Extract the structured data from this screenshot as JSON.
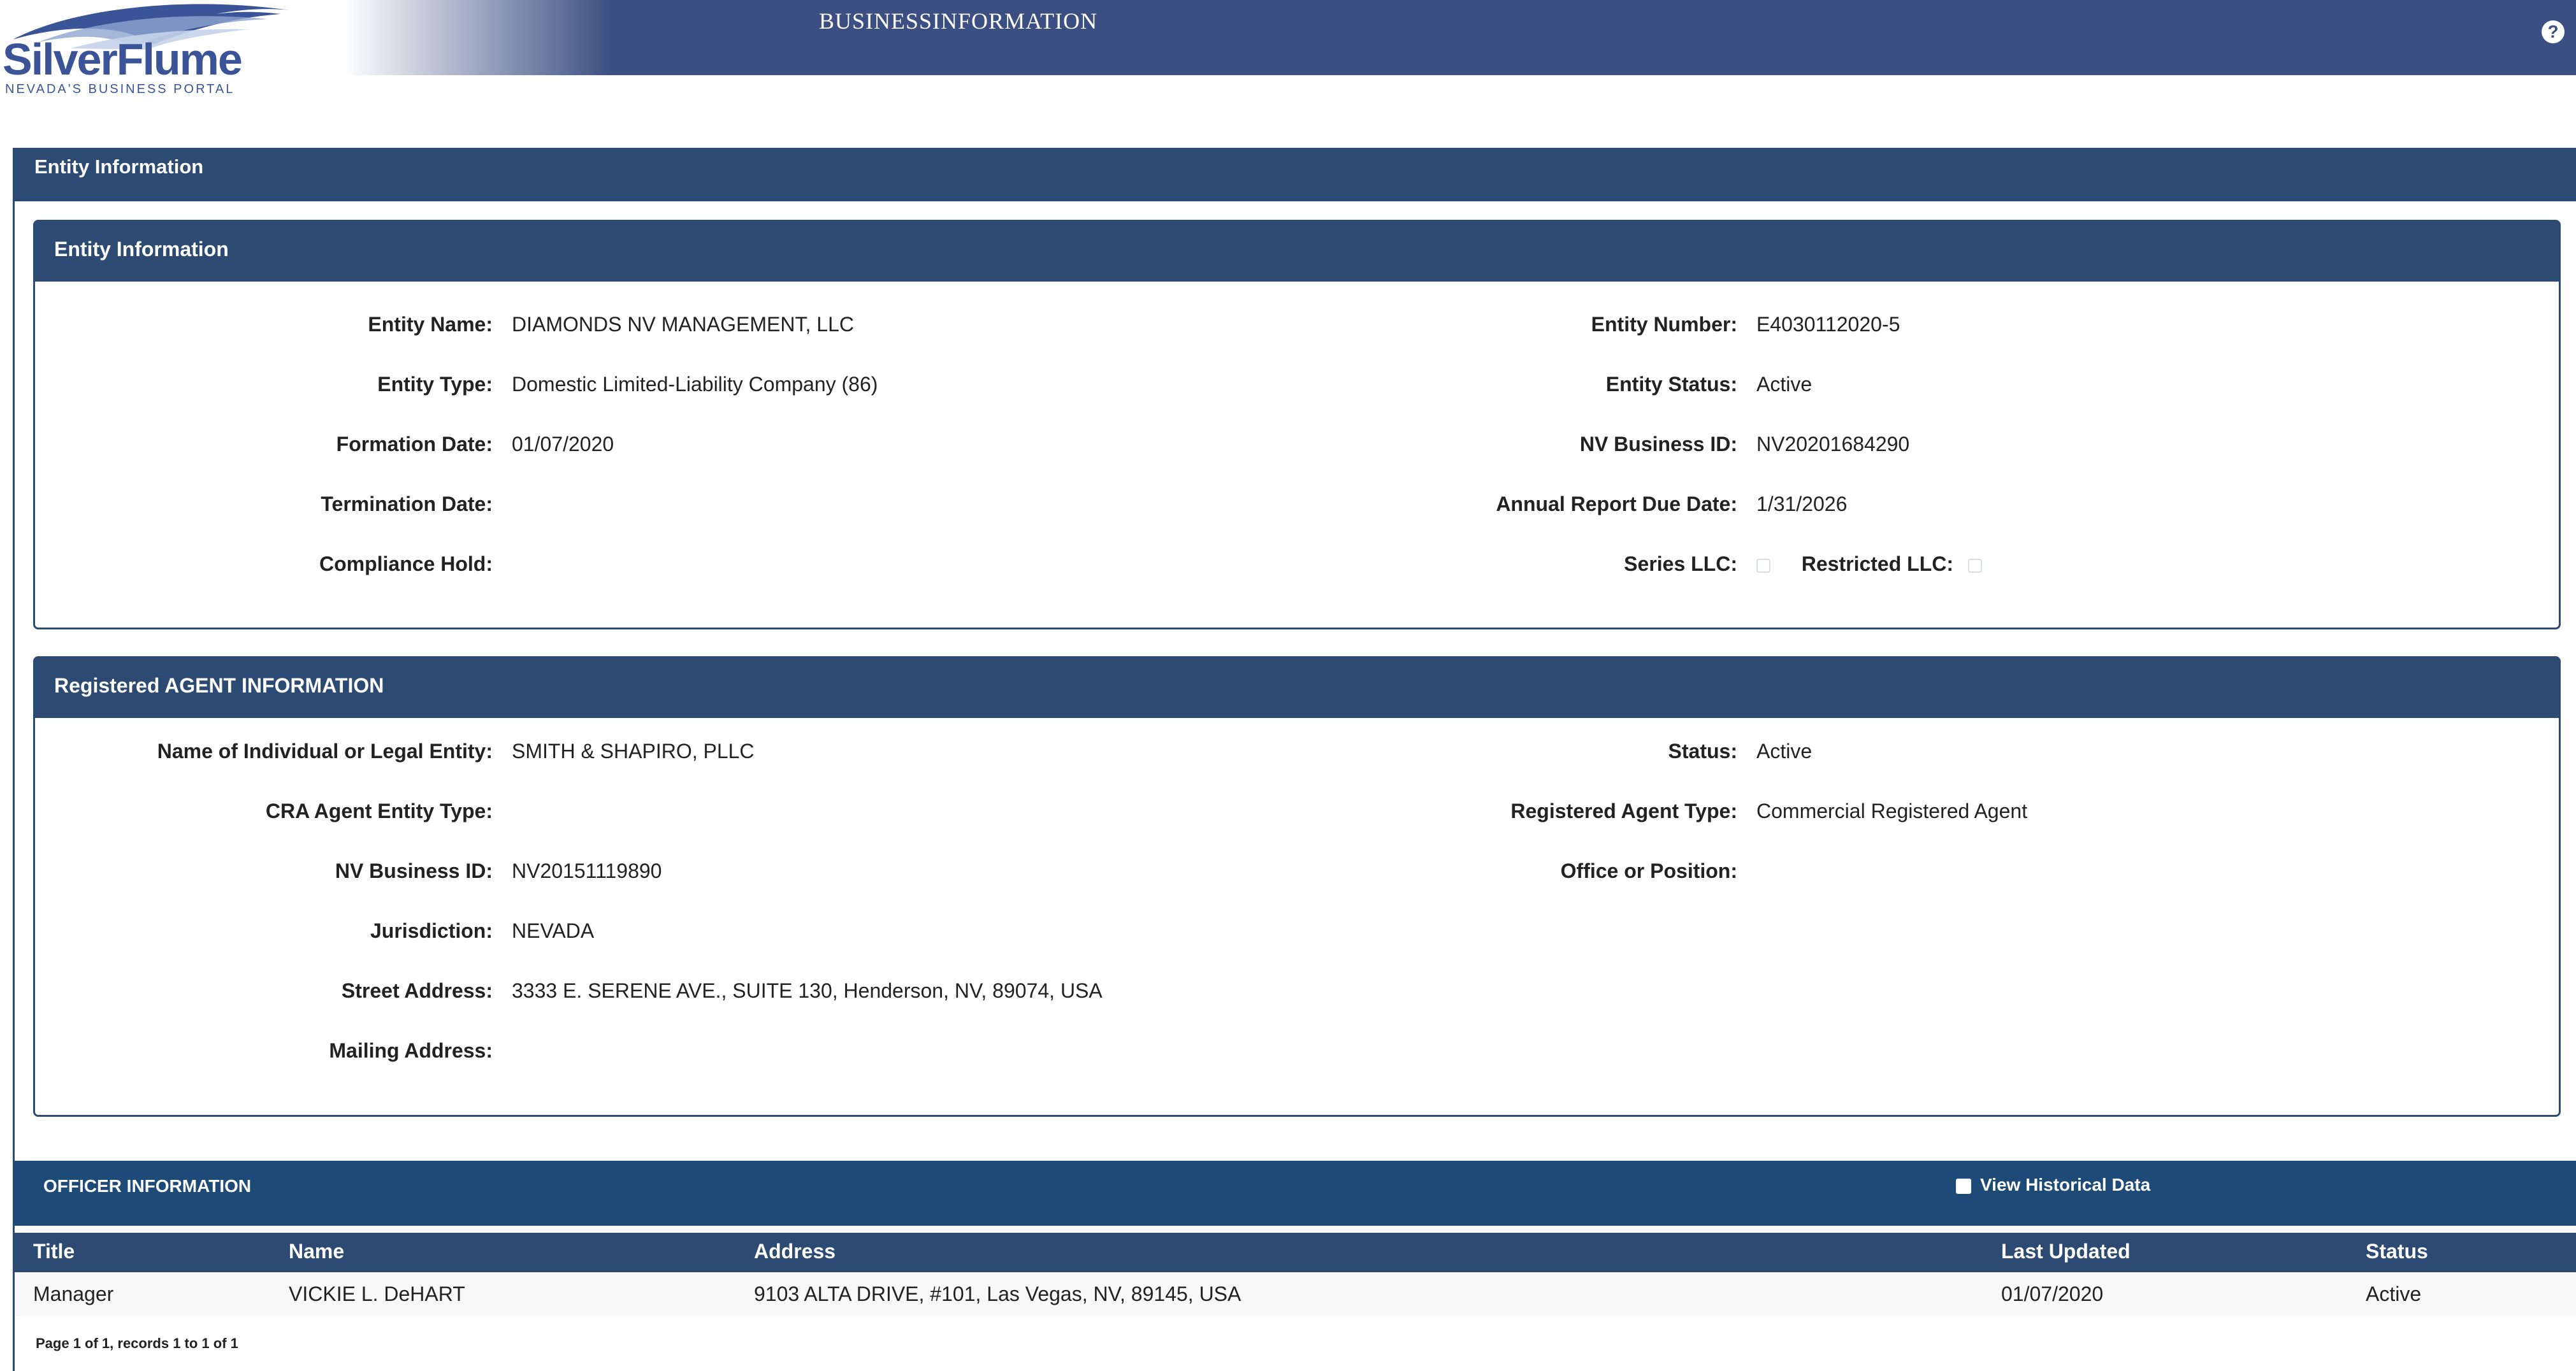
{
  "header": {
    "logo_main": "SilverFlume",
    "logo_sub": "NEVADA'S BUSINESS PORTAL",
    "page_heading": "BUSINESSINFORMATION",
    "help_icon": "question-circle-icon",
    "help_glyph": "?"
  },
  "colors": {
    "header_bar": "#3b4f82",
    "panel_header": "#2d4a72",
    "logo_blue": "#3b5498"
  },
  "outer_panel": {
    "title": "Entity Information"
  },
  "entity": {
    "title": "Entity Information",
    "left": [
      {
        "label": "Entity Name:",
        "value": "DIAMONDS NV MANAGEMENT, LLC"
      },
      {
        "label": "Entity Type:",
        "value": "Domestic Limited-Liability Company (86)"
      },
      {
        "label": "Formation Date:",
        "value": "01/07/2020"
      },
      {
        "label": "Termination Date:",
        "value": ""
      },
      {
        "label": "Compliance Hold:",
        "value": ""
      }
    ],
    "right": [
      {
        "label": "Entity Number:",
        "value": "E4030112020-5"
      },
      {
        "label": "Entity Status:",
        "value": "Active"
      },
      {
        "label": "NV Business ID:",
        "value": "NV20201684290"
      },
      {
        "label": "Annual Report Due Date:",
        "value": "1/31/2026"
      },
      {
        "label": "Series LLC:",
        "value": ""
      }
    ],
    "restricted_label": "Restricted LLC:",
    "series_llc_checked": false,
    "restricted_llc_checked": false
  },
  "agent": {
    "title": "Registered AGENT INFORMATION",
    "left": [
      {
        "label": "Name of Individual or Legal Entity:",
        "value": "SMITH & SHAPIRO, PLLC"
      },
      {
        "label": "CRA Agent Entity Type:",
        "value": ""
      },
      {
        "label": "NV Business ID:",
        "value": "NV20151119890"
      },
      {
        "label": "Jurisdiction:",
        "value": "NEVADA"
      },
      {
        "label": "Street Address:",
        "value": "3333 E. SERENE AVE., SUITE 130, Henderson, NV, 89074, USA"
      },
      {
        "label": "Mailing Address:",
        "value": ""
      }
    ],
    "right": [
      {
        "label": "Status:",
        "value": "Active"
      },
      {
        "label": "Registered Agent Type:",
        "value": "Commercial Registered Agent"
      },
      {
        "label": "Office or Position:",
        "value": ""
      }
    ]
  },
  "officers": {
    "title": "OFFICER INFORMATION",
    "view_historical_label": "View Historical Data",
    "view_historical_checked": false,
    "columns": [
      "Title",
      "Name",
      "Address",
      "Last Updated",
      "Status"
    ],
    "rows": [
      [
        "Manager",
        "VICKIE L. DeHART",
        "9103 ALTA DRIVE, #101, Las Vegas, NV, 89145, USA",
        "01/07/2020",
        "Active"
      ]
    ],
    "pager": "Page 1 of 1, records 1 to 1 of 1"
  }
}
